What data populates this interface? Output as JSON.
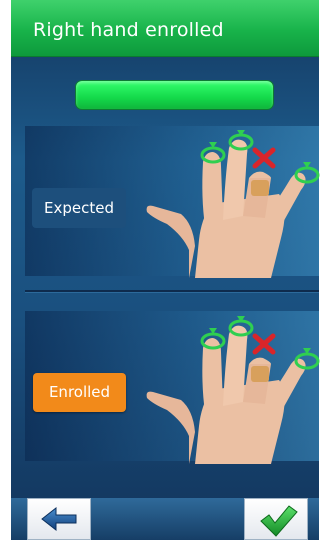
{
  "header": {
    "title": "Right hand enrolled"
  },
  "progress": {
    "fraction": 1.0
  },
  "expected_panel": {
    "label": "Expected",
    "excluded_finger": "middle-finger-bandaged"
  },
  "enrolled_panel": {
    "label": "Enrolled",
    "excluded_finger": "middle-finger-bandaged"
  },
  "footer": {
    "back_icon": "arrow-left-icon",
    "confirm_icon": "checkmark-icon"
  },
  "colors": {
    "title_green": "#18b34a",
    "enrolled_orange": "#f28a1a",
    "progress_green": "#14d94a"
  }
}
